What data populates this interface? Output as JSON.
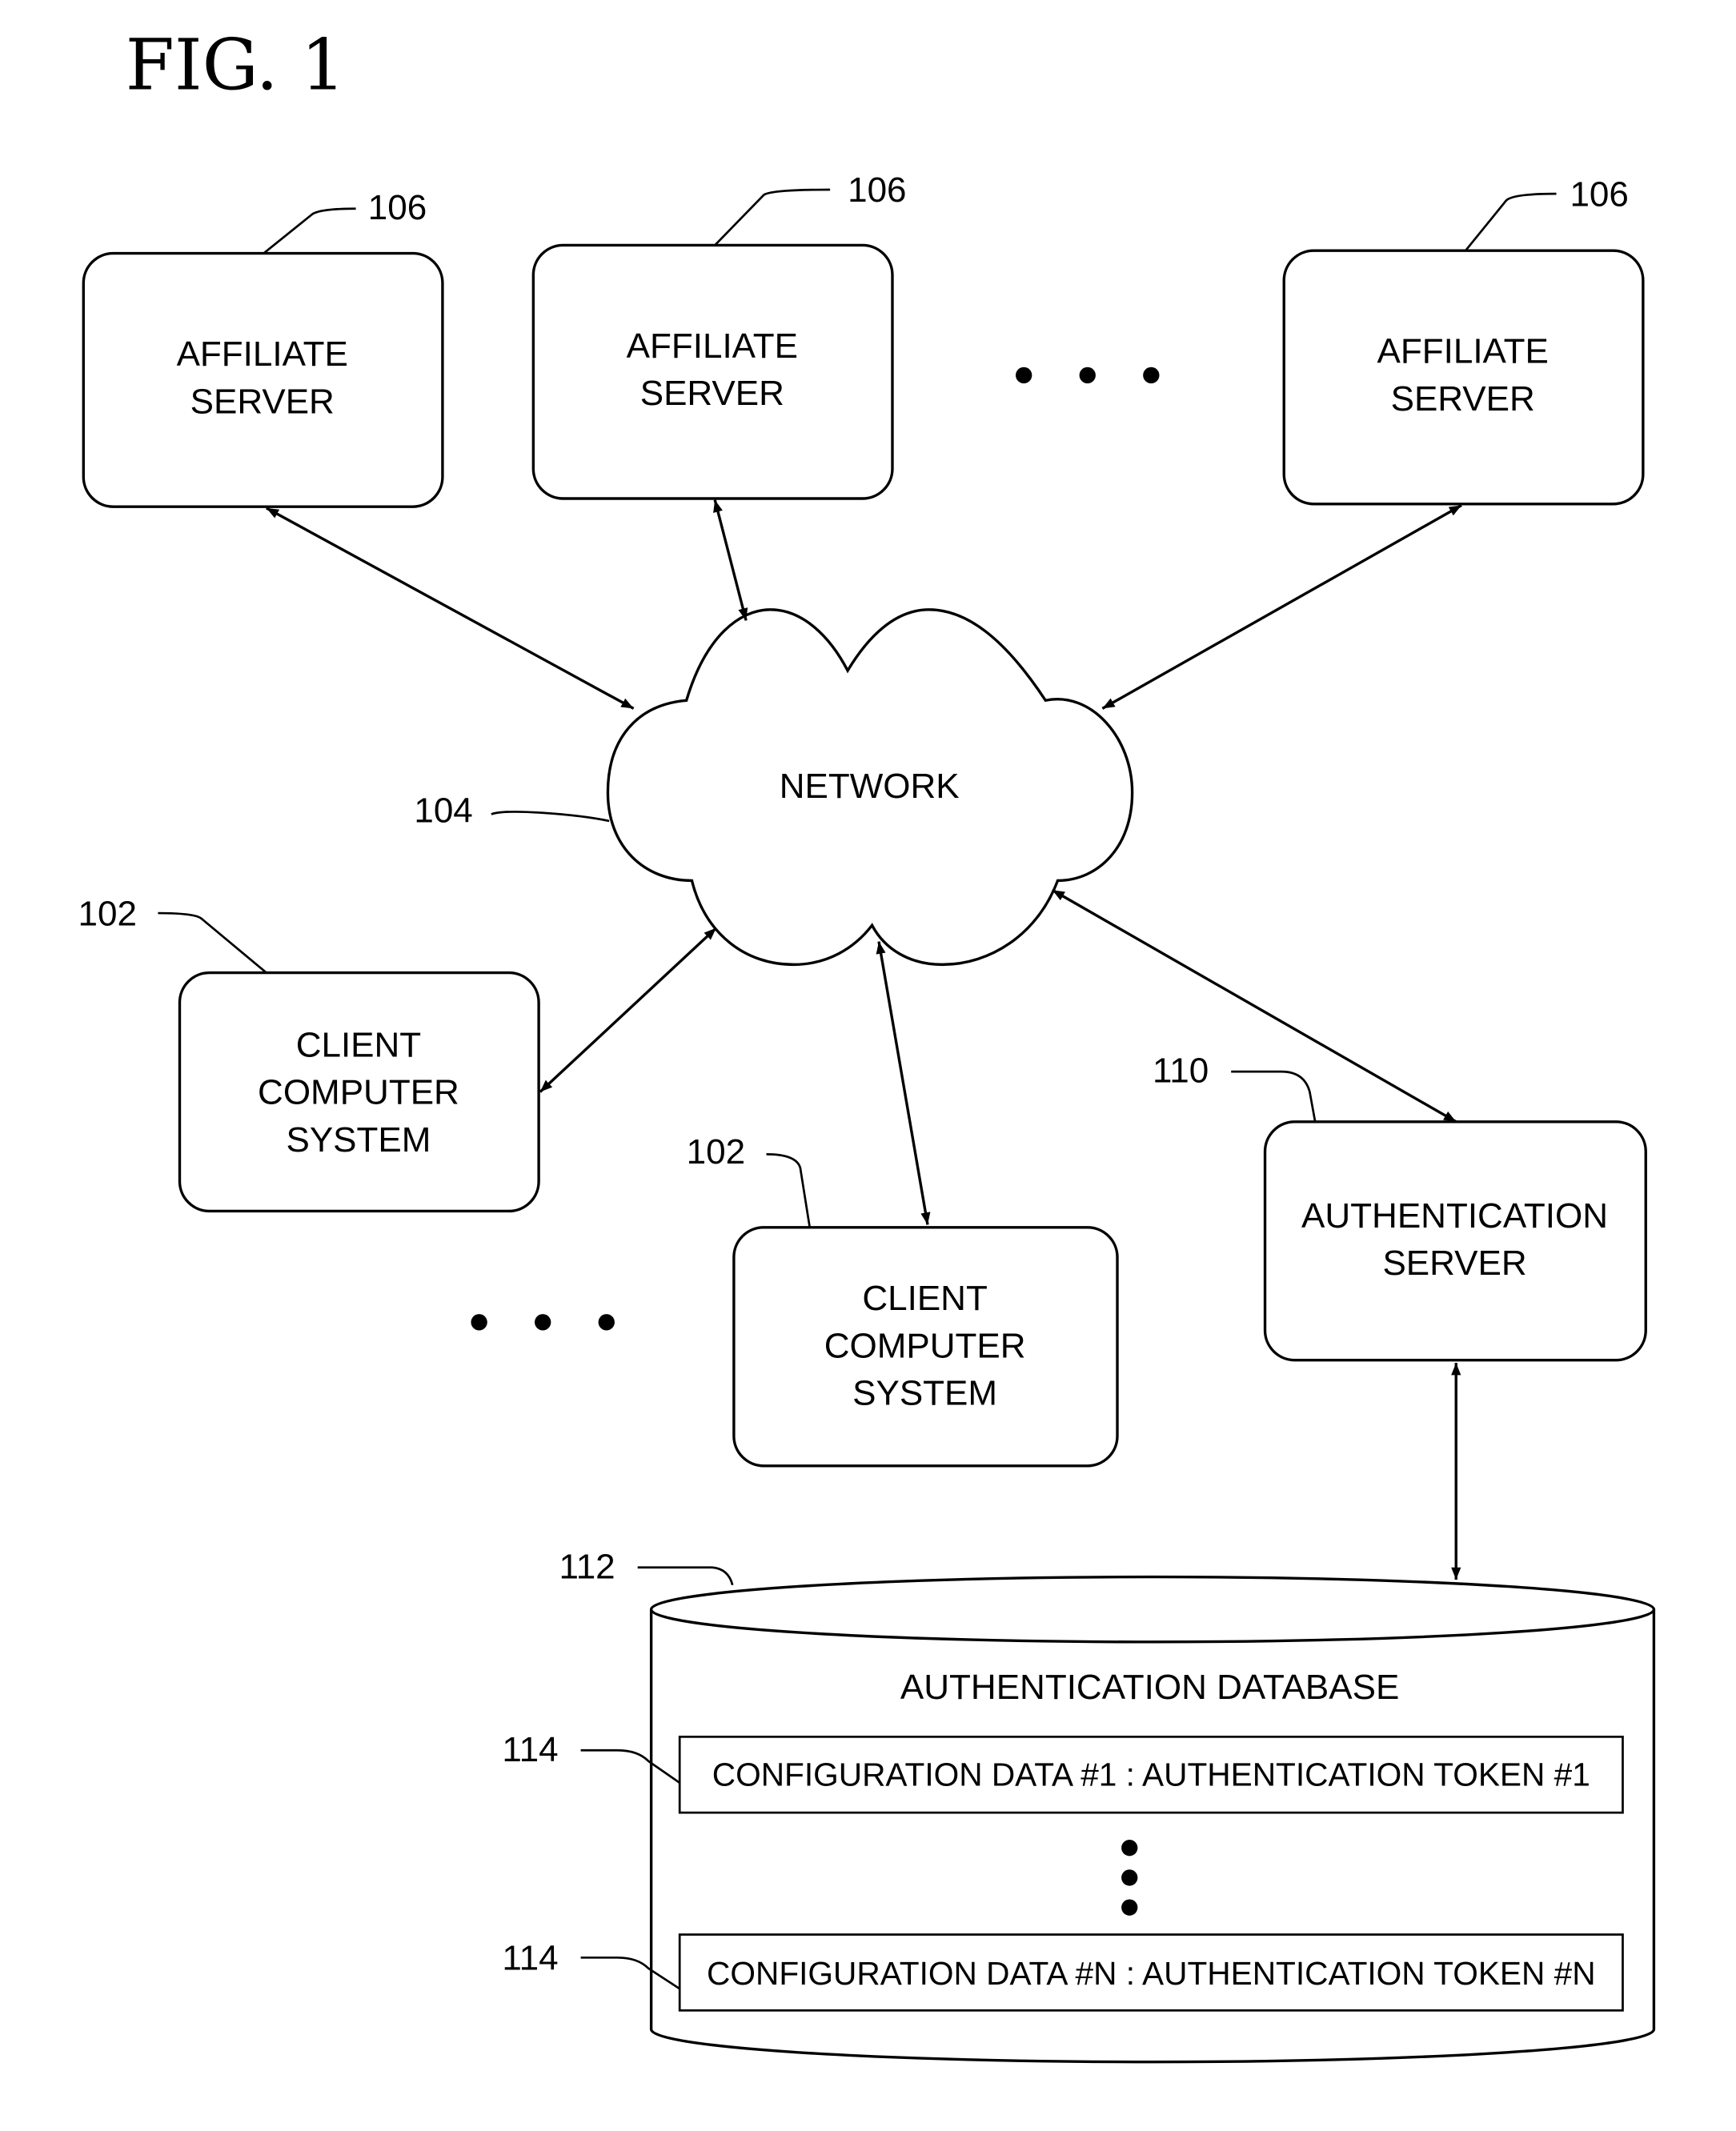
{
  "figure": {
    "title": "FIG. 1"
  },
  "affiliate_servers": [
    {
      "ref": "106",
      "lines": [
        "AFFILIATE",
        "SERVER"
      ]
    },
    {
      "ref": "106",
      "lines": [
        "AFFILIATE",
        "SERVER"
      ]
    },
    {
      "ref": "106",
      "lines": [
        "AFFILIATE",
        "SERVER"
      ]
    }
  ],
  "network": {
    "ref": "104",
    "label": "NETWORK"
  },
  "client_systems": [
    {
      "ref": "102",
      "lines": [
        "CLIENT",
        "COMPUTER",
        "SYSTEM"
      ]
    },
    {
      "ref": "102",
      "lines": [
        "CLIENT",
        "COMPUTER",
        "SYSTEM"
      ]
    }
  ],
  "auth_server": {
    "ref": "110",
    "lines": [
      "AUTHENTICATION",
      "SERVER"
    ]
  },
  "auth_database": {
    "ref": "112",
    "label": "AUTHENTICATION DATABASE",
    "records": [
      {
        "ref": "114",
        "text": "CONFIGURATION DATA #1 : AUTHENTICATION TOKEN #1"
      },
      {
        "ref": "114",
        "text": "CONFIGURATION DATA #N : AUTHENTICATION TOKEN #N"
      }
    ]
  },
  "colors": {
    "ink": "#000000",
    "paper": "#ffffff"
  }
}
